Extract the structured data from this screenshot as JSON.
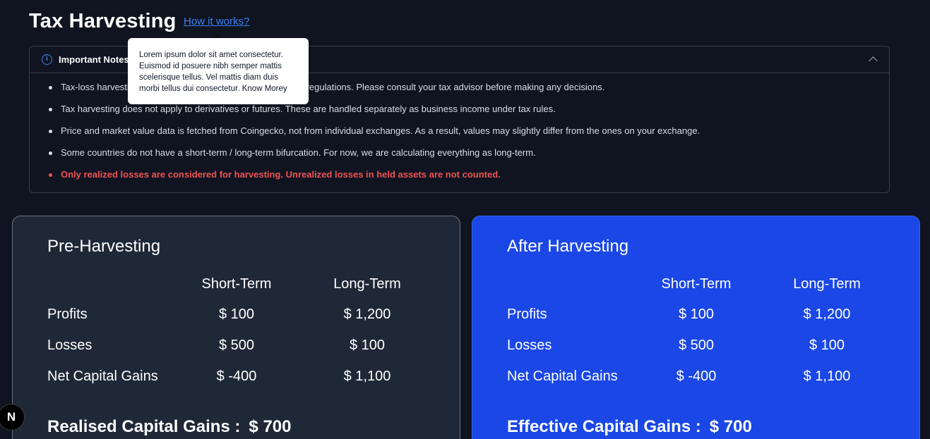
{
  "header": {
    "title": "Tax Harvesting",
    "how_link": "How it works?"
  },
  "tooltip": {
    "text": "Lorem ipsum dolor sit amet consectetur. Euismod id posuere nibh semper mattis scelerisque tellus. Vel mattis diam duis morbi tellus dui consectetur. Know Morey"
  },
  "notes": {
    "title": "Important Notes & Disclaimers",
    "items": [
      "Tax-loss harvesting is currently not allowed under Indian tax regulations. Please consult your tax advisor before making any decisions.",
      "Tax harvesting does not apply to derivatives or futures. These are handled separately as business income under tax rules.",
      "Price and market value data is fetched from Coingecko, not from individual exchanges. As a result, values may slightly differ from the ones on your exchange.",
      "Some countries do not have a short-term / long-term bifurcation. For now, we are calculating everything as long-term.",
      "Only realized losses are considered for harvesting. Unrealized losses in held assets are not counted."
    ]
  },
  "pre": {
    "title": "Pre-Harvesting",
    "col_short": "Short-Term",
    "col_long": "Long-Term",
    "rows": [
      {
        "label": "Profits",
        "short": "$ 100",
        "long": "$ 1,200"
      },
      {
        "label": "Losses",
        "short": "$ 500",
        "long": "$ 100"
      },
      {
        "label": "Net Capital Gains",
        "short": "$ -400",
        "long": "$ 1,100"
      }
    ],
    "total_label": "Realised Capital Gains :",
    "total_value": "$ 700"
  },
  "after": {
    "title": "After Harvesting",
    "col_short": "Short-Term",
    "col_long": "Long-Term",
    "rows": [
      {
        "label": "Profits",
        "short": "$ 100",
        "long": "$ 1,200"
      },
      {
        "label": "Losses",
        "short": "$ 500",
        "long": "$ 100"
      },
      {
        "label": "Net Capital Gains",
        "short": "$ -400",
        "long": "$ 1,100"
      }
    ],
    "total_label": "Effective Capital Gains :",
    "total_value": "$ 700"
  },
  "badge": {
    "letter": "N"
  },
  "colors": {
    "background": "#0f1420",
    "link": "#3b82f6",
    "warning": "#f05252",
    "after_card": "#1a47e5",
    "pre_card": "#1f2837"
  }
}
